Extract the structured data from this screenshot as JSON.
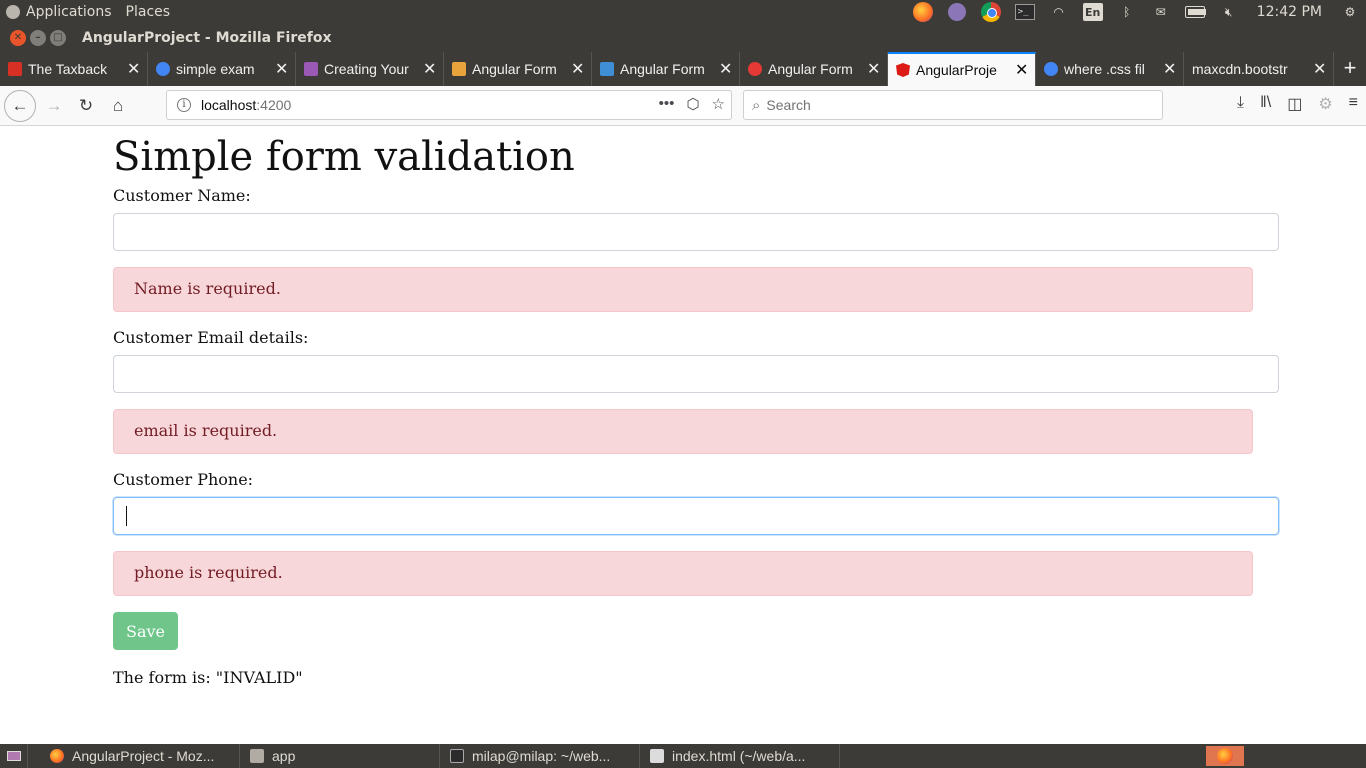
{
  "top_panel": {
    "menu": [
      "Applications",
      "Places"
    ],
    "clock": "12:42 PM",
    "keyboard": "En"
  },
  "window": {
    "title": "AngularProject - Mozilla Firefox"
  },
  "tabs": [
    {
      "label": "The Taxback",
      "fav_color": "#d93025"
    },
    {
      "label": "simple exam",
      "fav_color": "#4285f4"
    },
    {
      "label": "Creating Your",
      "fav_color": "#9b59b6"
    },
    {
      "label": "Angular Form",
      "fav_color": "#e8a33d"
    },
    {
      "label": "Angular Form",
      "fav_color": "#3f8fd6"
    },
    {
      "label": "Angular Form",
      "fav_color": "#e53935"
    },
    {
      "label": "AngularProje",
      "fav_color": "#dd1b16",
      "active": true
    },
    {
      "label": "where .css fil",
      "fav_color": "#4285f4"
    },
    {
      "label": "maxcdn.bootstr",
      "fav_color": "#3c3b37"
    }
  ],
  "nav": {
    "url_host": "localhost",
    "url_port": ":4200",
    "search_placeholder": "Search"
  },
  "form": {
    "title": "Simple form validation",
    "name_label": "Customer Name:",
    "name_value": "",
    "name_error": "Name is required.",
    "email_label": "Customer Email details:",
    "email_value": "",
    "email_error": "email is required.",
    "phone_label": "Customer Phone:",
    "phone_value": "",
    "phone_error": "phone is required.",
    "save_label": "Save",
    "status_text": "The form is: \"INVALID\""
  },
  "taskbar": {
    "items": [
      "AngularProject - Moz...",
      "app",
      "milap@milap: ~/web...",
      "index.html (~/web/a..."
    ]
  },
  "colors": {
    "alert_bg": "#f8d7da",
    "alert_text": "#721c24",
    "save_button": "#6fc58a",
    "active_tab_accent": "#0a84ff"
  }
}
